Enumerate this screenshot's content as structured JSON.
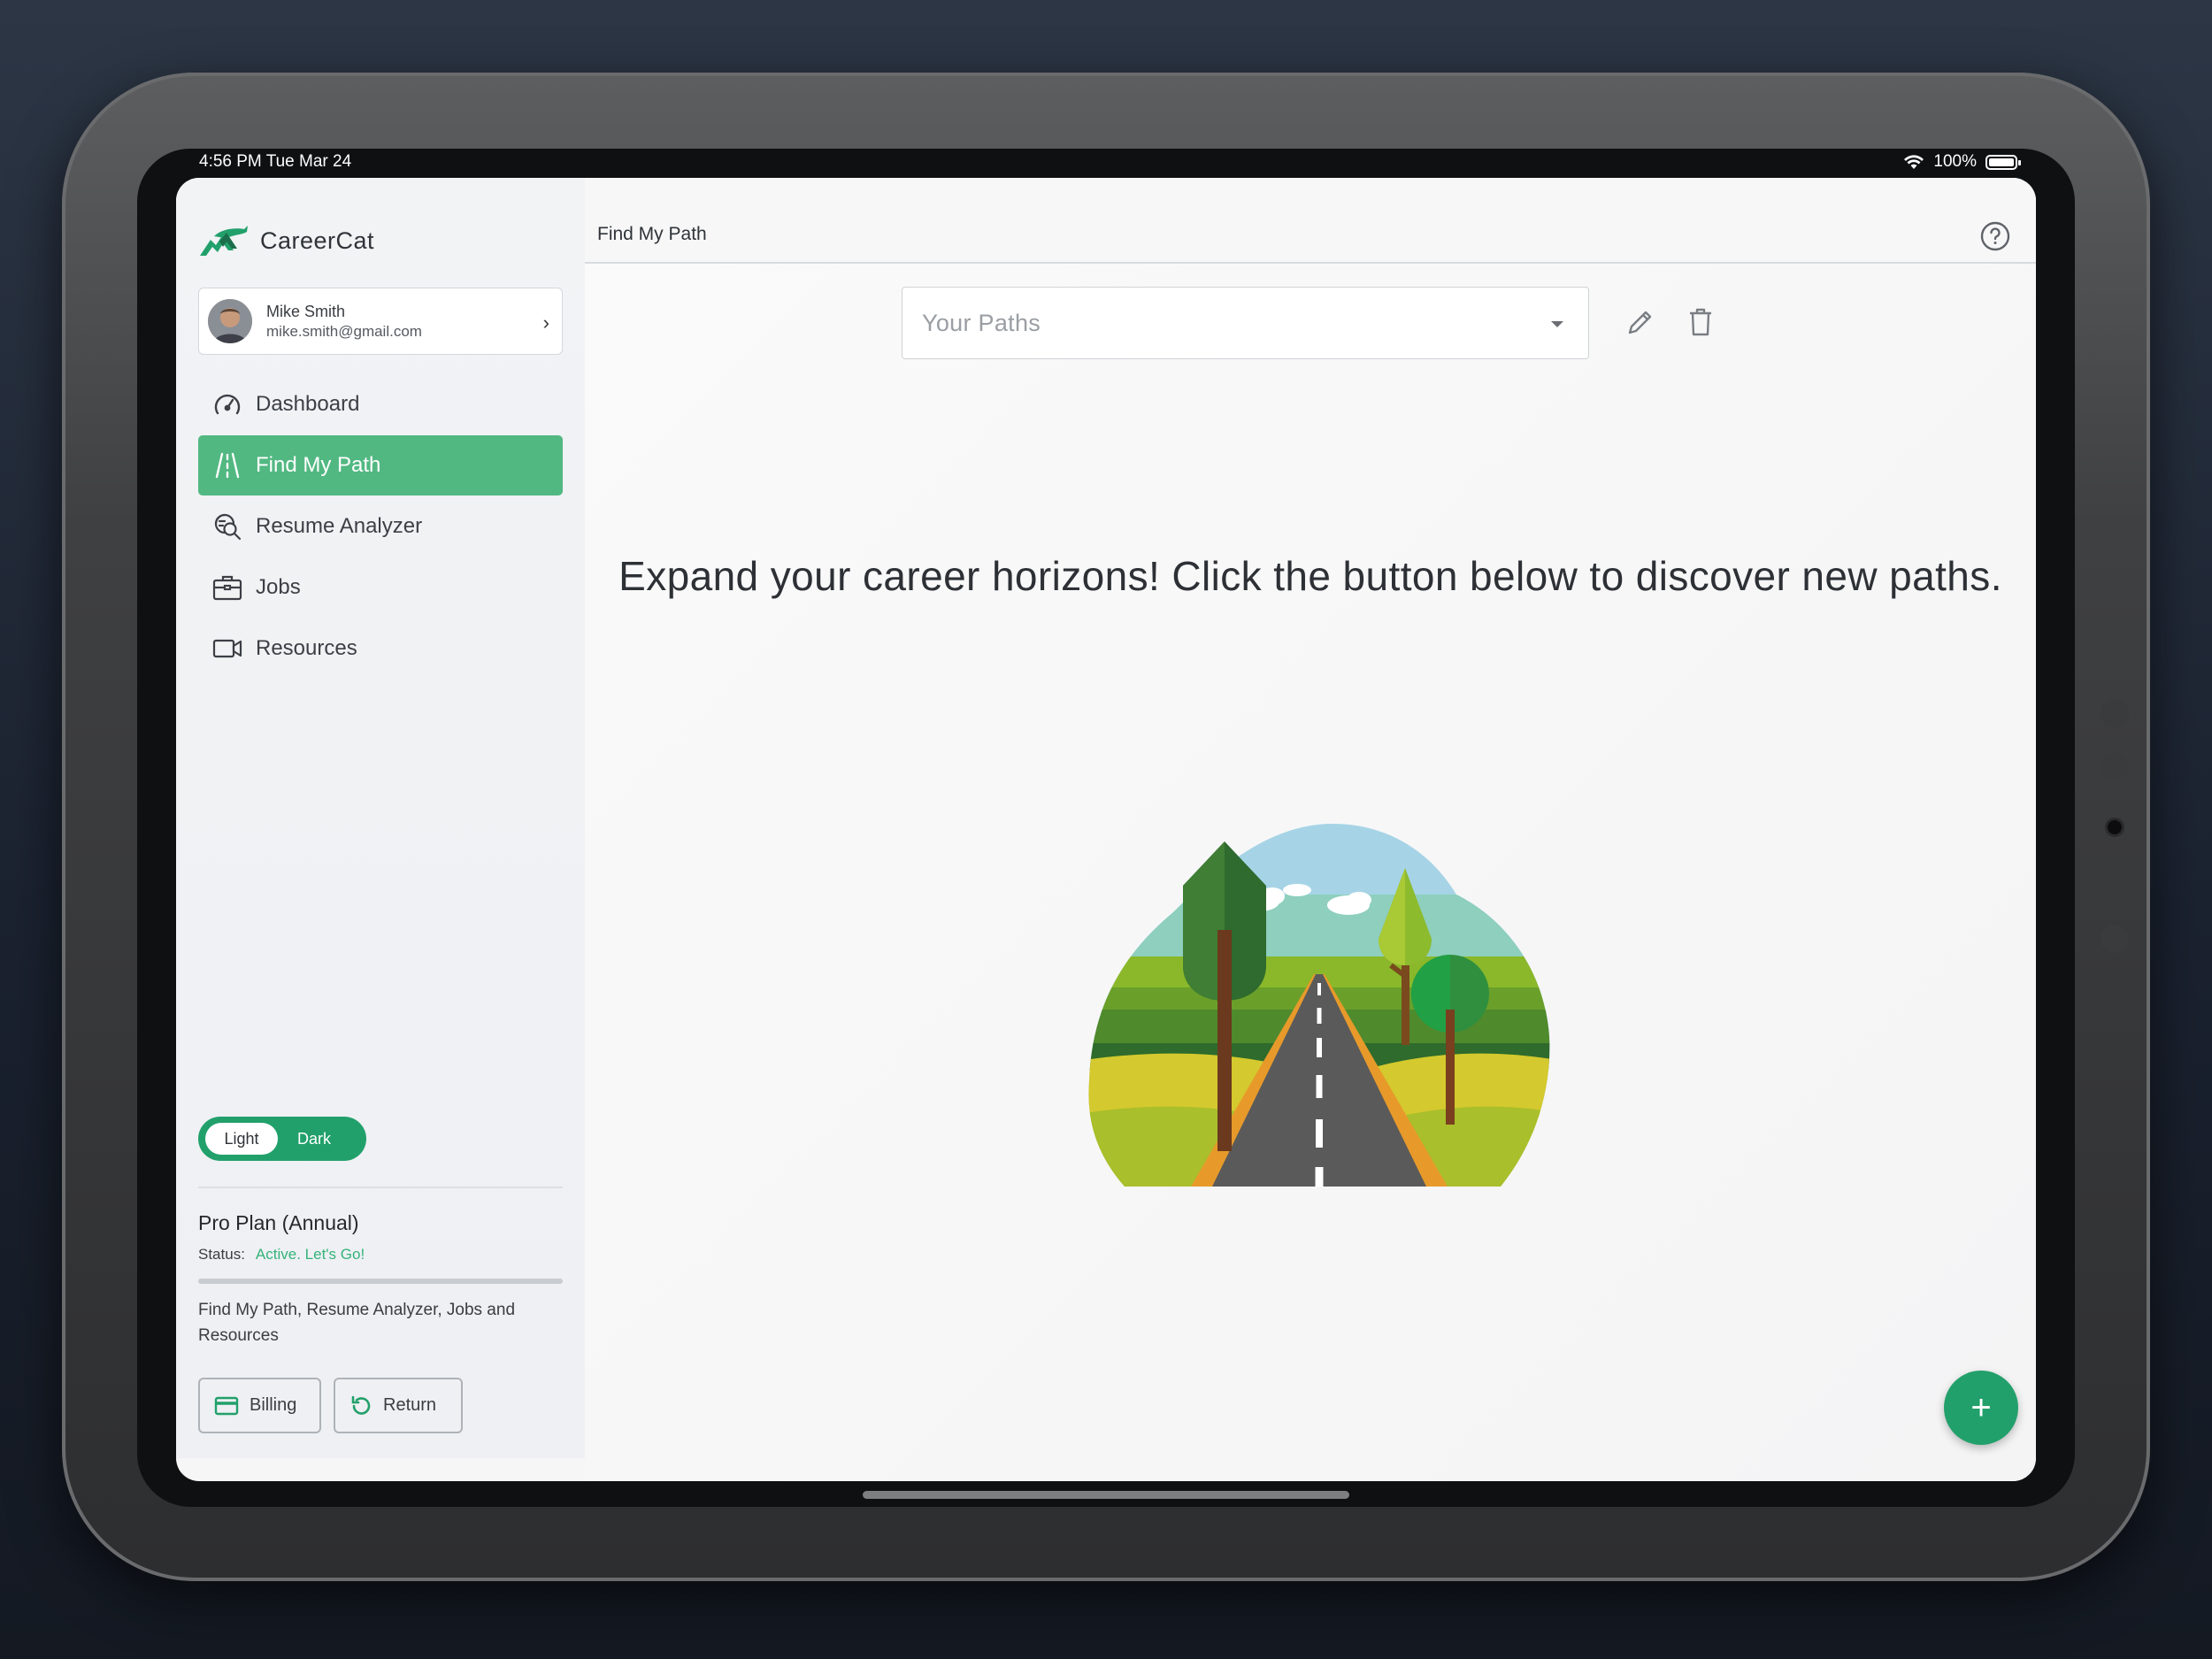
{
  "status_bar": {
    "time": "4:56 PM   Tue Mar 24",
    "battery": "100%"
  },
  "app": {
    "name": "CareerCat"
  },
  "profile": {
    "name": "Mike Smith",
    "email": "mike.smith@gmail.com"
  },
  "nav": {
    "items": [
      {
        "label": "Dashboard",
        "icon": "speedometer-icon",
        "active": false
      },
      {
        "label": "Find My Path",
        "icon": "road-icon",
        "active": true
      },
      {
        "label": "Resume Analyzer",
        "icon": "resume-search-icon",
        "active": false
      },
      {
        "label": "Jobs",
        "icon": "briefcase-icon",
        "active": false
      },
      {
        "label": "Resources",
        "icon": "video-camera-icon",
        "active": false
      }
    ]
  },
  "theme_toggle": {
    "light": "Light",
    "dark": "Dark",
    "selected": "Light"
  },
  "plan": {
    "title": "Pro Plan (Annual)",
    "status_label": "Status:",
    "status_value": "Active. Let's Go!",
    "features": "Find My Path, Resume Analyzer, Jobs and Resources",
    "billing_label": "Billing",
    "return_label": "Return"
  },
  "main": {
    "page_title": "Find My Path",
    "select_placeholder": "Your Paths",
    "headline": "Expand your career horizons! Click the button below to discover new paths.",
    "fab_label": "+"
  },
  "colors": {
    "accent": "#22a06b",
    "nav_active": "#52b882",
    "status_active": "#34b37a"
  }
}
